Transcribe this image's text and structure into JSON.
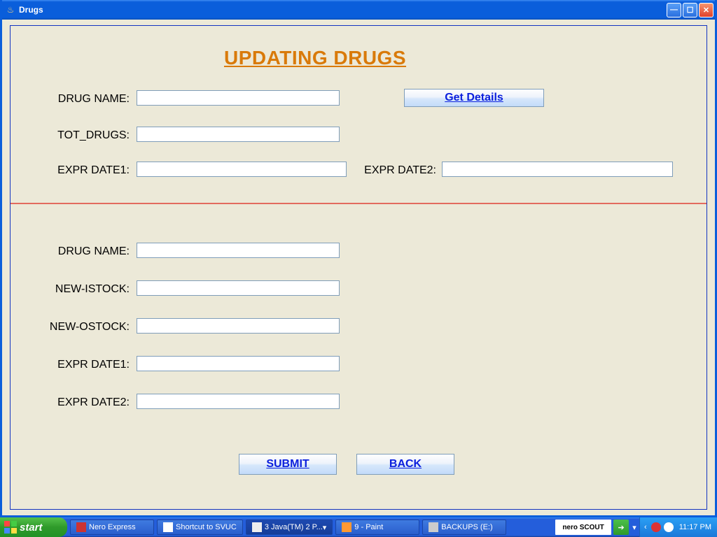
{
  "window": {
    "title": "Drugs"
  },
  "heading": "UPDATING DRUGS",
  "top_section": {
    "drug_name_label": "DRUG NAME:",
    "drug_name_value": "",
    "tot_drugs_label": "TOT_DRUGS:",
    "tot_drugs_value": "",
    "expr_date1_label": "EXPR DATE1:",
    "expr_date1_value": "",
    "expr_date2_label": "EXPR DATE2:",
    "expr_date2_value": "",
    "get_details_label": "Get Details"
  },
  "bottom_section": {
    "drug_name_label": "DRUG NAME:",
    "drug_name_value": "",
    "new_istock_label": "NEW-ISTOCK:",
    "new_istock_value": "",
    "new_ostock_label": "NEW-OSTOCK:",
    "new_ostock_value": "",
    "expr_date1_label": "EXPR DATE1:",
    "expr_date1_value": "",
    "expr_date2_label": "EXPR DATE2:",
    "expr_date2_value": ""
  },
  "actions": {
    "submit_label": "SUBMIT",
    "back_label": "BACK"
  },
  "taskbar": {
    "start": "start",
    "items": [
      {
        "label": "Nero Express"
      },
      {
        "label": "Shortcut to SVUC"
      },
      {
        "label": "3 Java(TM) 2 P...",
        "active": true,
        "dropdown": true
      },
      {
        "label": "9 - Paint"
      },
      {
        "label": "BACKUPS (E:)"
      }
    ],
    "nero": "nero SCOUT",
    "clock": "11:17 PM"
  }
}
